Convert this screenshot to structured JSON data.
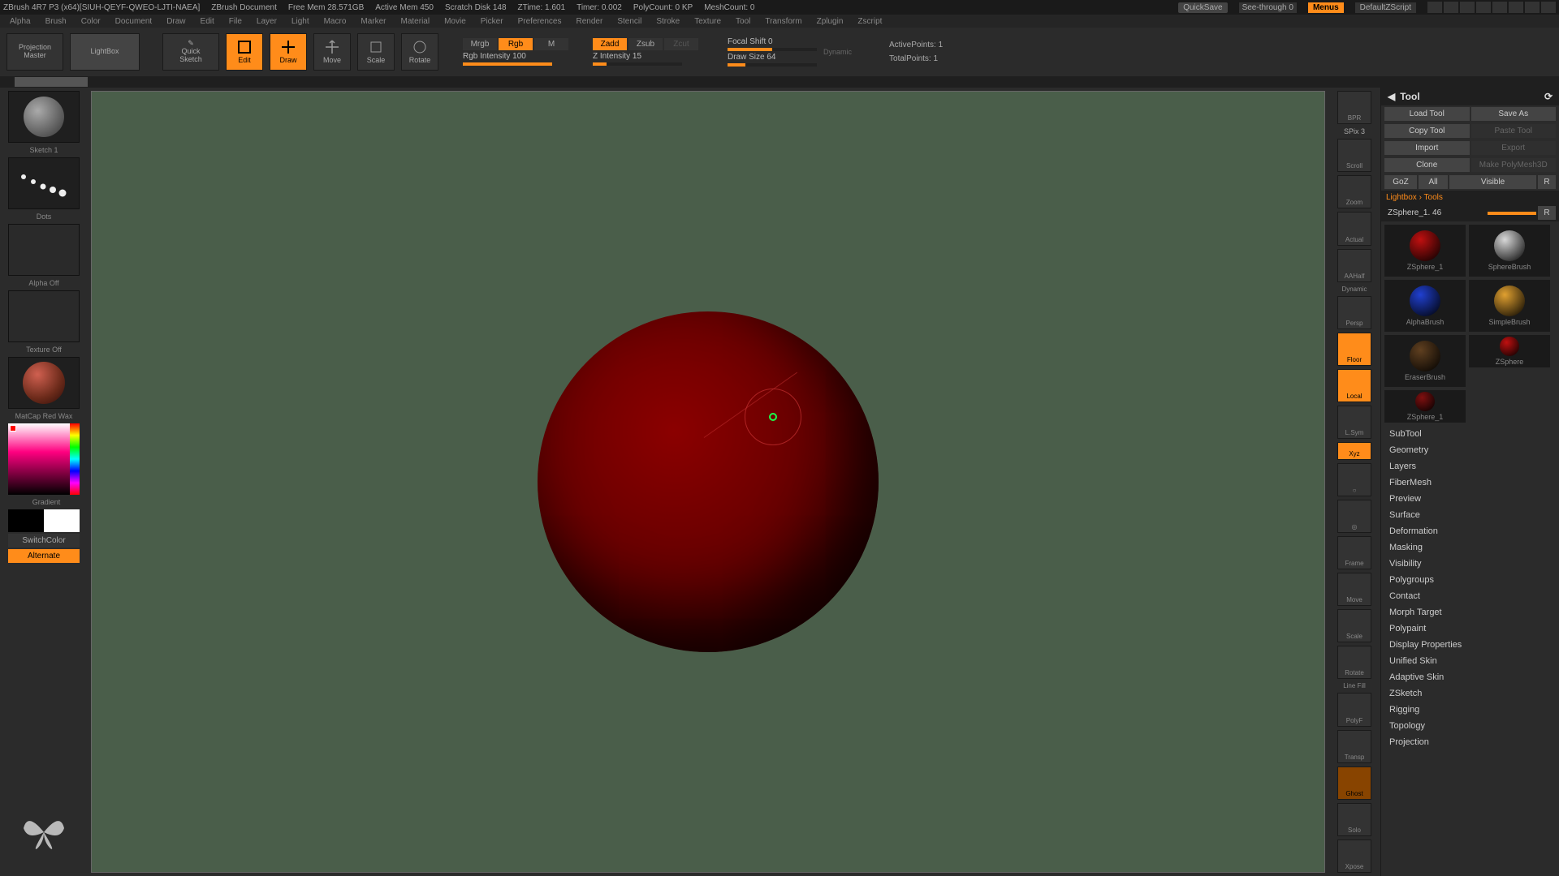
{
  "title": {
    "app": "ZBrush 4R7 P3 (x64)[SIUH-QEYF-QWEO-LJTI-NAEA]",
    "doc": "ZBrush Document",
    "mem": "Free Mem 28.571GB",
    "active_mem": "Active Mem 450",
    "scratch": "Scratch Disk 148",
    "ztime": "ZTime: 1.601",
    "timer": "Timer: 0.002",
    "poly": "PolyCount: 0 KP",
    "mesh": "MeshCount: 0",
    "quicksave": "QuickSave",
    "see_through": "See-through  0",
    "menus": "Menus",
    "script": "DefaultZScript"
  },
  "menus": [
    "Alpha",
    "Brush",
    "Color",
    "Document",
    "Draw",
    "Edit",
    "File",
    "Layer",
    "Light",
    "Macro",
    "Marker",
    "Material",
    "Movie",
    "Picker",
    "Preferences",
    "Render",
    "Stencil",
    "Stroke",
    "Texture",
    "Tool",
    "Transform",
    "Zplugin",
    "Zscript"
  ],
  "top": {
    "projection": "Projection\nMaster",
    "lightbox": "LightBox",
    "quicksketch": "Quick\nSketch",
    "edit": "Edit",
    "draw": "Draw",
    "move": "Move",
    "scale": "Scale",
    "rotate": "Rotate",
    "mrgb": "Mrgb",
    "rgb": "Rgb",
    "m": "M",
    "rgb_intensity": "Rgb Intensity 100",
    "zadd": "Zadd",
    "zsub": "Zsub",
    "zcut": "Zcut",
    "z_intensity": "Z Intensity 15",
    "focal": "Focal Shift 0",
    "drawsize": "Draw Size 64",
    "dynamic": "Dynamic",
    "active_pts": "ActivePoints: 1",
    "total_pts": "TotalPoints: 1"
  },
  "left": {
    "sketch": "Sketch 1",
    "dots": "Dots",
    "alpha": "Alpha Off",
    "texture": "Texture Off",
    "material": "MatCap Red Wax",
    "gradient": "Gradient",
    "switchcolor": "SwitchColor",
    "alternate": "Alternate"
  },
  "rshelf": {
    "bpr": "BPR",
    "spix": "SPix 3",
    "scroll": "Scroll",
    "zoom": "Zoom",
    "actual": "Actual",
    "aahalf": "AAHalf",
    "persp": "Persp",
    "dynamic": "Dynamic",
    "floor": "Floor",
    "local": "Local",
    "lsym": "L.Sym",
    "xyz": "Xyz",
    "frame": "Frame",
    "move": "Move",
    "scale": "Scale",
    "rotate": "Rotate",
    "linefill": "Line Fill",
    "polyf": "PolyF",
    "transp": "Transp",
    "ghost": "Ghost",
    "solo": "Solo",
    "xpose": "Xpose"
  },
  "toolpanel": {
    "title": "Tool",
    "load": "Load Tool",
    "save": "Save As",
    "copy": "Copy Tool",
    "paste": "Paste Tool",
    "import": "Import",
    "export": "Export",
    "clone": "Clone",
    "polymesh": "Make PolyMesh3D",
    "goz": "GoZ",
    "all": "All",
    "visible": "Visible",
    "r": "R",
    "lbtools": "Lightbox › Tools",
    "current": "ZSphere_1. 46",
    "r2": "R",
    "tools": [
      {
        "name": "ZSphere_1",
        "color": "#c01010"
      },
      {
        "name": "SphereBrush",
        "color": "#d8d8d8"
      },
      {
        "name": "AlphaBrush",
        "color": "#2040d0"
      },
      {
        "name": "SimpleBrush",
        "color": "#e0a030"
      },
      {
        "name": "EraserBrush",
        "color": "#604020"
      },
      {
        "name": "ZSphere",
        "color": "#c01010"
      },
      {
        "name": "ZSphere_1",
        "color": "#801010"
      }
    ],
    "subs": [
      "SubTool",
      "Geometry",
      "Layers",
      "FiberMesh",
      "Preview",
      "Surface",
      "Deformation",
      "Masking",
      "Visibility",
      "Polygroups",
      "Contact",
      "Morph Target",
      "Polypaint",
      "Display Properties",
      "Unified Skin",
      "Adaptive Skin",
      "ZSketch",
      "Rigging",
      "Topology",
      "Projection"
    ]
  }
}
